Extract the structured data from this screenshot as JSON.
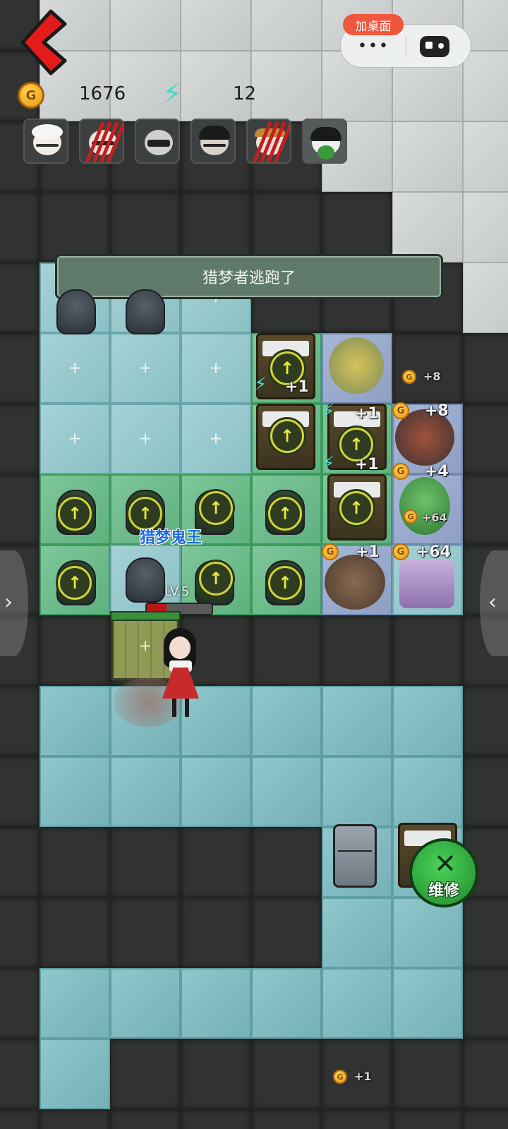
{
  "hud": {
    "coins": "1676",
    "energy": "12",
    "coin_symbol": "G"
  },
  "miniprogram": {
    "add_to_desktop": "加桌面",
    "more_symbol": "•••"
  },
  "notice": "猎梦者逃跑了",
  "boss": {
    "name": "猎梦鬼王",
    "level": "LV.5",
    "hp_fraction": 0.3
  },
  "gains": {
    "g1": "+1",
    "g2": "+1",
    "g3": "+1",
    "g4": "+8",
    "g5": "+8",
    "g6": "+4",
    "g7": "+64",
    "g8": "+1",
    "g9": "+64",
    "g10": "+1"
  },
  "repair_label": "维修",
  "colors": {
    "accent_red": "#f0553d",
    "energy": "#3fd9c8",
    "boss_name": "#1f6ae3",
    "repair_green": "#2fae3c"
  },
  "icons": [
    "back-arrow-icon",
    "coin-icon",
    "lightning-icon",
    "more-icon",
    "gamepad-icon",
    "upgrade-arrow-icon",
    "wrench-icon"
  ]
}
